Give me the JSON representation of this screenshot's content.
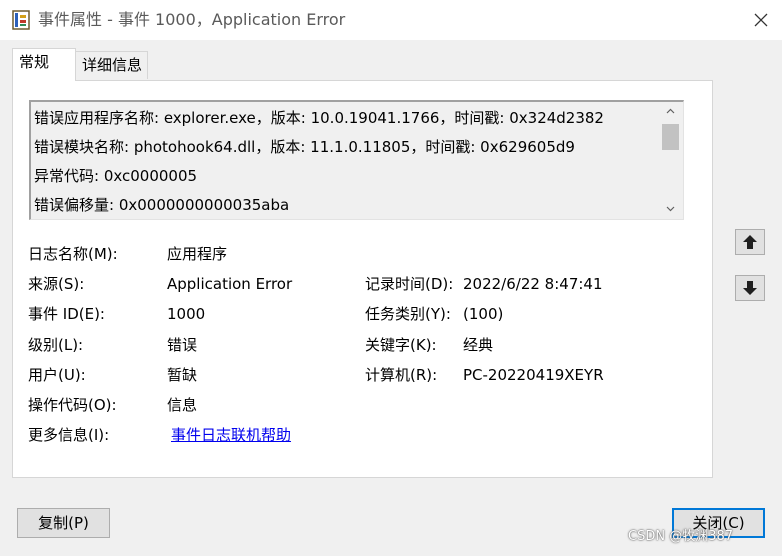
{
  "window": {
    "title": "事件属性 - 事件 1000，Application Error",
    "close_icon": "close-icon"
  },
  "tabs": [
    {
      "label": "常规",
      "active": true
    },
    {
      "label": "详细信息",
      "active": false
    }
  ],
  "description_lines": [
    "错误应用程序名称: explorer.exe，版本: 10.0.19041.1766，时间戳: 0x324d2382",
    "错误模块名称: photohook64.dll，版本: 11.1.0.11805，时间戳: 0x629605d9",
    "异常代码: 0xc0000005",
    "错误偏移量: 0x0000000000035aba"
  ],
  "fields": {
    "log_name": {
      "label": "日志名称(M):",
      "value": "应用程序"
    },
    "source": {
      "label": "来源(S):",
      "value": "Application Error"
    },
    "logged": {
      "label": "记录时间(D):",
      "value": "2022/6/22 8:47:41"
    },
    "event_id": {
      "label": "事件 ID(E):",
      "value": "1000"
    },
    "task_category": {
      "label": "任务类别(Y):",
      "value": "(100)"
    },
    "level": {
      "label": "级别(L):",
      "value": "错误"
    },
    "keywords": {
      "label": "关键字(K):",
      "value": "经典"
    },
    "user": {
      "label": "用户(U):",
      "value": "暂缺"
    },
    "computer": {
      "label": "计算机(R):",
      "value": "PC-20220419XEYR"
    },
    "opcode": {
      "label": "操作代码(O):",
      "value": "信息"
    },
    "more_info": {
      "label": "更多信息(I):",
      "link": "事件日志联机帮助"
    }
  },
  "buttons": {
    "copy": "复制(P)",
    "close": "关闭(C)"
  },
  "watermark": "CSDN @牧渊387",
  "colors": {
    "link": "#0000ee",
    "accent": "#0078d7",
    "background": "#f0f0f0"
  }
}
